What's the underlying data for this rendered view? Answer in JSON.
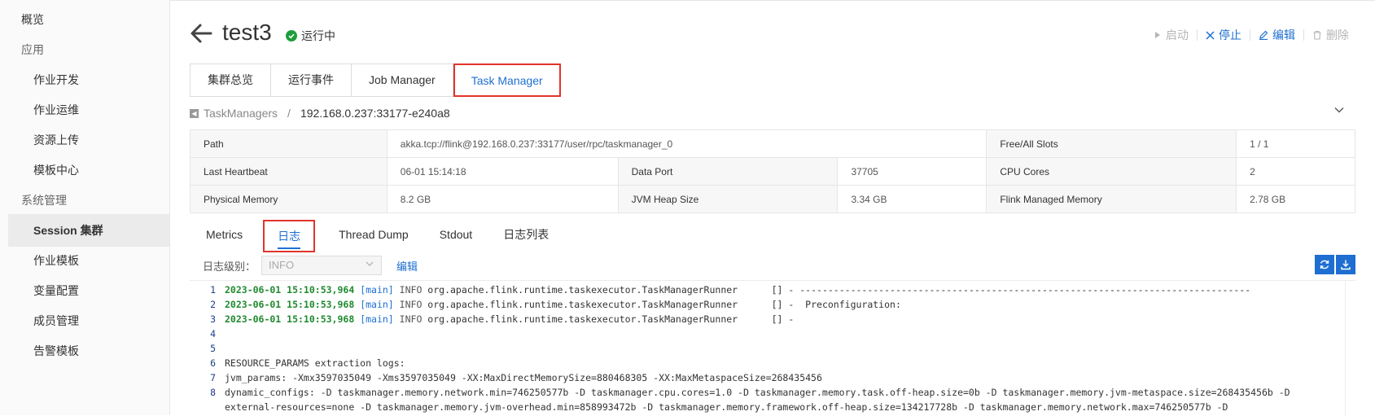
{
  "sidebar": {
    "items": [
      {
        "label": "概览",
        "type": "top"
      },
      {
        "label": "应用",
        "type": "group"
      },
      {
        "label": "作业开发",
        "type": "sub"
      },
      {
        "label": "作业运维",
        "type": "sub"
      },
      {
        "label": "资源上传",
        "type": "sub"
      },
      {
        "label": "模板中心",
        "type": "sub"
      },
      {
        "label": "系统管理",
        "type": "group"
      },
      {
        "label": "Session 集群",
        "type": "sub",
        "active": true
      },
      {
        "label": "作业模板",
        "type": "sub"
      },
      {
        "label": "变量配置",
        "type": "sub"
      },
      {
        "label": "成员管理",
        "type": "sub"
      },
      {
        "label": "告警模板",
        "type": "sub"
      }
    ]
  },
  "header": {
    "title": "test3",
    "status": "运行中",
    "actions": {
      "start": "启动",
      "stop": "停止",
      "edit": "编辑",
      "delete": "删除"
    }
  },
  "tabs": [
    "集群总览",
    "运行事件",
    "Job Manager",
    "Task Manager"
  ],
  "breadcrumb": {
    "parent": "TaskManagers",
    "separator": "/",
    "current": "192.168.0.237:33177-e240a8"
  },
  "info": {
    "path_label": "Path",
    "path_value": "akka.tcp://flink@192.168.0.237:33177/user/rpc/taskmanager_0",
    "slots_label": "Free/All Slots",
    "slots_value": "1 / 1",
    "heartbeat_label": "Last Heartbeat",
    "heartbeat_value": "06-01 15:14:18",
    "dataport_label": "Data Port",
    "dataport_value": "37705",
    "cpu_label": "CPU Cores",
    "cpu_value": "2",
    "physmem_label": "Physical Memory",
    "physmem_value": "8.2 GB",
    "heap_label": "JVM Heap Size",
    "heap_value": "3.34 GB",
    "managed_label": "Flink Managed Memory",
    "managed_value": "2.78 GB"
  },
  "subtabs": [
    "Metrics",
    "日志",
    "Thread Dump",
    "Stdout",
    "日志列表"
  ],
  "log_controls": {
    "level_label": "日志级别：",
    "level_value": "INFO",
    "edit_label": "编辑"
  },
  "log_lines": [
    {
      "num": "1",
      "ts": "2023-06-01 15:10:53,964",
      "thread": "[main]",
      "level": "INFO",
      "msg": " org.apache.flink.runtime.taskexecutor.TaskManagerRunner      [] - --------------------------------------------------------------------------------"
    },
    {
      "num": "2",
      "ts": "2023-06-01 15:10:53,968",
      "thread": "[main]",
      "level": "INFO",
      "msg": " org.apache.flink.runtime.taskexecutor.TaskManagerRunner      [] -  Preconfiguration:"
    },
    {
      "num": "3",
      "ts": "2023-06-01 15:10:53,968",
      "thread": "[main]",
      "level": "INFO",
      "msg": " org.apache.flink.runtime.taskexecutor.TaskManagerRunner      [] -"
    },
    {
      "num": "4",
      "ts": "",
      "thread": "",
      "level": "",
      "msg": ""
    },
    {
      "num": "5",
      "ts": "",
      "thread": "",
      "level": "",
      "msg": ""
    },
    {
      "num": "6",
      "ts": "",
      "thread": "",
      "level": "",
      "msg": "RESOURCE_PARAMS extraction logs:"
    },
    {
      "num": "7",
      "ts": "",
      "thread": "",
      "level": "",
      "msg": "jvm_params: -Xmx3597035049 -Xms3597035049 -XX:MaxDirectMemorySize=880468305 -XX:MaxMetaspaceSize=268435456"
    },
    {
      "num": "8",
      "ts": "",
      "thread": "",
      "level": "",
      "msg": "dynamic_configs: -D taskmanager.memory.network.min=746250577b -D taskmanager.cpu.cores=1.0 -D taskmanager.memory.task.off-heap.size=0b -D taskmanager.memory.jvm-metaspace.size=268435456b -D"
    }
  ],
  "log_wrap": "external-resources=none -D taskmanager.memory.jvm-overhead.min=858993472b -D taskmanager.memory.framework.off-heap.size=134217728b -D taskmanager.memory.network.max=746250577b -D",
  "colors": {
    "accent": "#1e6fd1",
    "highlight": "#e0352b",
    "running": "#1e9e3b"
  }
}
